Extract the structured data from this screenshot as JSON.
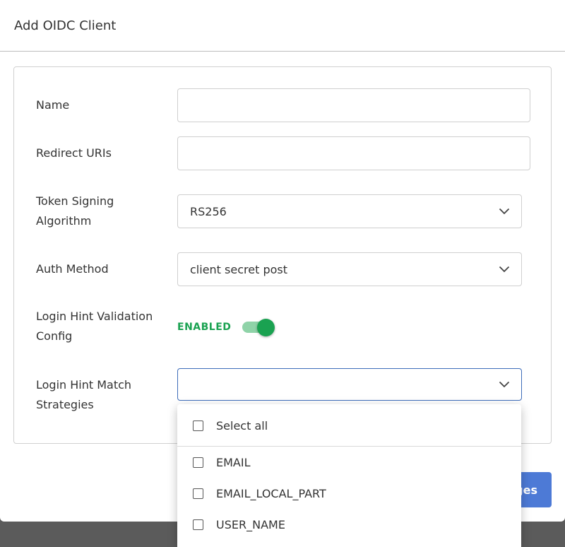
{
  "dialog": {
    "title": "Add OIDC Client"
  },
  "form": {
    "name": {
      "label": "Name",
      "value": "",
      "placeholder": ""
    },
    "redirect_uris": {
      "label": "Redirect URIs",
      "value": "",
      "placeholder": ""
    },
    "token_signing_algorithm": {
      "label": "Token Signing Algorithm",
      "value": "RS256"
    },
    "auth_method": {
      "label": "Auth Method",
      "value": "client secret post"
    },
    "login_hint_validation": {
      "label": "Login Hint Validation Config",
      "state_label": "ENABLED",
      "enabled": true
    },
    "login_hint_match_strategies": {
      "label": "Login Hint Match Strategies",
      "value": ""
    }
  },
  "dropdown": {
    "select_all_label": "Select all",
    "options": [
      "EMAIL",
      "EMAIL_LOCAL_PART",
      "USER_NAME"
    ]
  },
  "footer": {
    "save_label_visible": "ges"
  },
  "colors": {
    "enabled_green": "#1aa251",
    "primary_blue": "#4d7ad6",
    "focus_border": "#3d6cb9",
    "backdrop": "#5b5b5b"
  }
}
